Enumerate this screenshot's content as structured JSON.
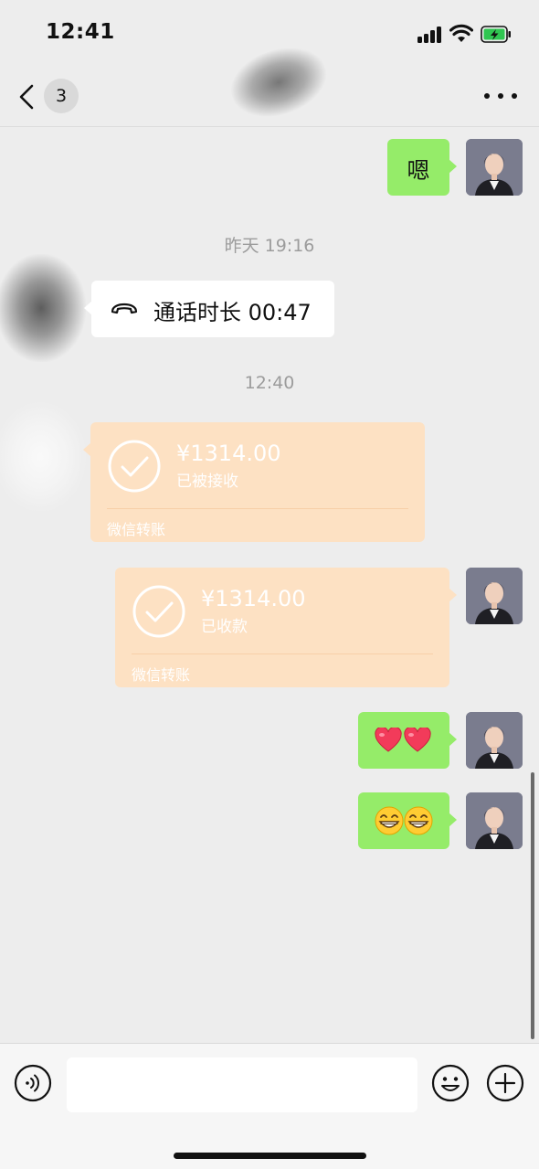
{
  "status_bar": {
    "time": "12:41",
    "battery": "charging"
  },
  "nav": {
    "unread_count": "3"
  },
  "messages": {
    "m1_text": "嗯",
    "ts1": "昨天 19:16",
    "call_text": "通话时长 00:47",
    "ts2": "12:40",
    "transfer1": {
      "amount": "¥1314.00",
      "status": "已被接收",
      "label": "微信转账"
    },
    "transfer2": {
      "amount": "¥1314.00",
      "status": "已收款",
      "label": "微信转账"
    },
    "hearts": "❤️❤️",
    "grins": "😁😁"
  },
  "colors": {
    "sent_bubble": "#95ec69",
    "transfer_bubble": "#fde1c3",
    "background": "#ededed"
  }
}
